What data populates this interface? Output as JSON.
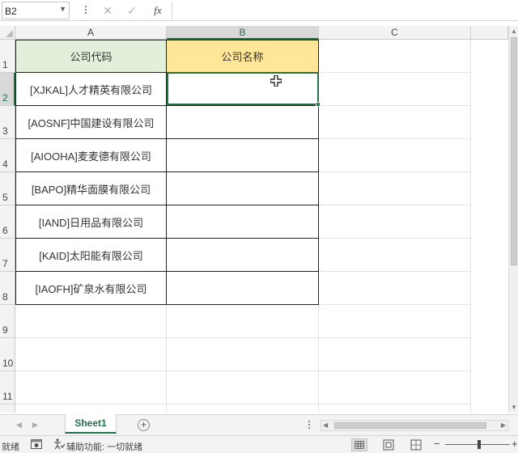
{
  "formula_bar": {
    "name_box": "B2",
    "formula": ""
  },
  "columns": [
    "A",
    "B",
    "C"
  ],
  "rows": [
    "1",
    "2",
    "3",
    "4",
    "5",
    "6",
    "7",
    "8",
    "9",
    "10",
    "11"
  ],
  "sheet": {
    "header": {
      "a": "公司代码",
      "b": "公司名称"
    },
    "data": [
      {
        "a": "[XJKAL]人才精英有限公司",
        "b": ""
      },
      {
        "a": "[AOSNF]中国建设有限公司",
        "b": ""
      },
      {
        "a": "[AIOOHA]麦麦德有限公司",
        "b": ""
      },
      {
        "a": "[BAPO]精华面膜有限公司",
        "b": ""
      },
      {
        "a": "[IAND]日用品有限公司",
        "b": ""
      },
      {
        "a": "[KAID]太阳能有限公司",
        "b": ""
      },
      {
        "a": "[IAOFH]矿泉水有限公司",
        "b": ""
      }
    ]
  },
  "tabs": {
    "sheet1": "Sheet1"
  },
  "status": {
    "ready": "就绪",
    "accessibility": "辅助功能: 一切就绪"
  },
  "colors": {
    "accent": "#217346",
    "header_a_fill": "#e2efda",
    "header_b_fill": "#ffe699"
  },
  "icons": [
    "cancel-icon",
    "enter-icon",
    "function-icon",
    "add-sheet-icon",
    "macro-record-icon",
    "accessibility-icon",
    "normal-view-icon",
    "page-layout-view-icon",
    "page-break-view-icon"
  ]
}
